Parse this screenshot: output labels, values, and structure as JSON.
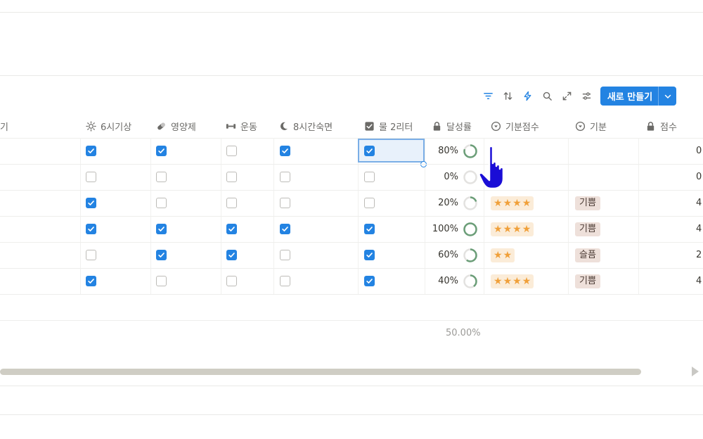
{
  "toolbar": {
    "icons": [
      "filter-icon",
      "sort-icon",
      "automation-lightning-icon",
      "search-icon",
      "expand-icon",
      "settings-sliders-icon"
    ],
    "new_button_label": "새로 만들기",
    "accent_color": "#2383e2"
  },
  "columns": [
    {
      "label": "일기",
      "icon": "diary-icon"
    },
    {
      "label": "6시기상",
      "icon": "sun-icon"
    },
    {
      "label": "영양제",
      "icon": "pill-icon"
    },
    {
      "label": "운동",
      "icon": "dumbbell-icon"
    },
    {
      "label": "8시간숙면",
      "icon": "moon-icon"
    },
    {
      "label": "물 2리터",
      "icon": "checkbox-icon"
    },
    {
      "label": "달성률",
      "icon": "lock-icon"
    },
    {
      "label": "기분점수",
      "icon": "dropdown-circle-icon"
    },
    {
      "label": "기분",
      "icon": "dropdown-circle-icon"
    },
    {
      "label": "점수",
      "icon": "lock-icon"
    }
  ],
  "rows": [
    {
      "checks": [
        true,
        true,
        false,
        true,
        true
      ],
      "rate": "80%",
      "rate_value": 0.8,
      "stars": 0,
      "mood": "",
      "score": "0"
    },
    {
      "checks": [
        false,
        false,
        false,
        false,
        false
      ],
      "rate": "0%",
      "rate_value": 0.0,
      "stars": 0,
      "mood": "",
      "score": "0"
    },
    {
      "checks": [
        true,
        false,
        false,
        false,
        false
      ],
      "rate": "20%",
      "rate_value": 0.2,
      "stars": 4,
      "mood": "기쁨",
      "score": "4"
    },
    {
      "checks": [
        true,
        true,
        true,
        true,
        true
      ],
      "rate": "100%",
      "rate_value": 1.0,
      "stars": 4,
      "mood": "기쁨",
      "score": "4"
    },
    {
      "checks": [
        false,
        true,
        true,
        false,
        true
      ],
      "rate": "60%",
      "rate_value": 0.6,
      "stars": 2,
      "mood": "슬픔",
      "score": "2"
    },
    {
      "checks": [
        true,
        false,
        false,
        false,
        true
      ],
      "rate": "40%",
      "rate_value": 0.4,
      "stars": 4,
      "mood": "기쁨",
      "score": "4"
    }
  ],
  "footer": {
    "average": "50.00%"
  },
  "colors": {
    "ring": "#6b9e78",
    "ring_track": "#e3e2e0",
    "star": "#f0a03a",
    "tag_bg": "#eee0da"
  },
  "cursor": "hand-pointer-icon"
}
